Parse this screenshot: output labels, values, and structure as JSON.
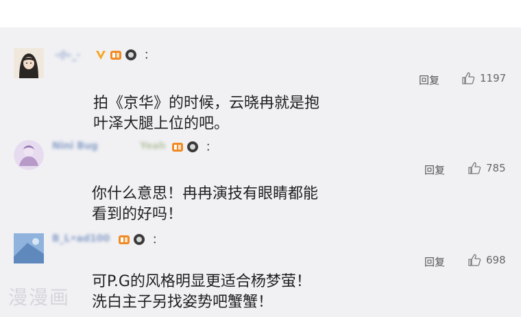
{
  "comments": [
    {
      "username": "·小·_·",
      "colon": "：",
      "reply_label": "回复",
      "like_count": "1197",
      "text_lines": [
        "拍《京华》的时候，云晓冉就是抱",
        "叶泽大腿上位的吧。"
      ]
    },
    {
      "username": "Nini Bug",
      "username2": "Yeah",
      "colon": "：",
      "reply_label": "回复",
      "like_count": "785",
      "text_lines": [
        "你什么意思！冉冉演技有眼睛都能",
        "看到的好吗！"
      ]
    },
    {
      "username": "B_L•ad100",
      "colon": "：",
      "reply_label": "回复",
      "like_count": "698",
      "text_lines": [
        "可P.G的风格明显更适合杨梦萤！",
        "洗白主子另找姿势吧蟹蟹！"
      ]
    }
  ],
  "watermark": "漫漫画",
  "colors": {
    "background": "#f1f1f4",
    "text": "#1f1f1f",
    "vip_v": "#f5a623"
  },
  "icons": [
    "thumbs-up-icon",
    "v-badge-icon",
    "level-badge-icon",
    "emblem-badge-icon"
  ]
}
